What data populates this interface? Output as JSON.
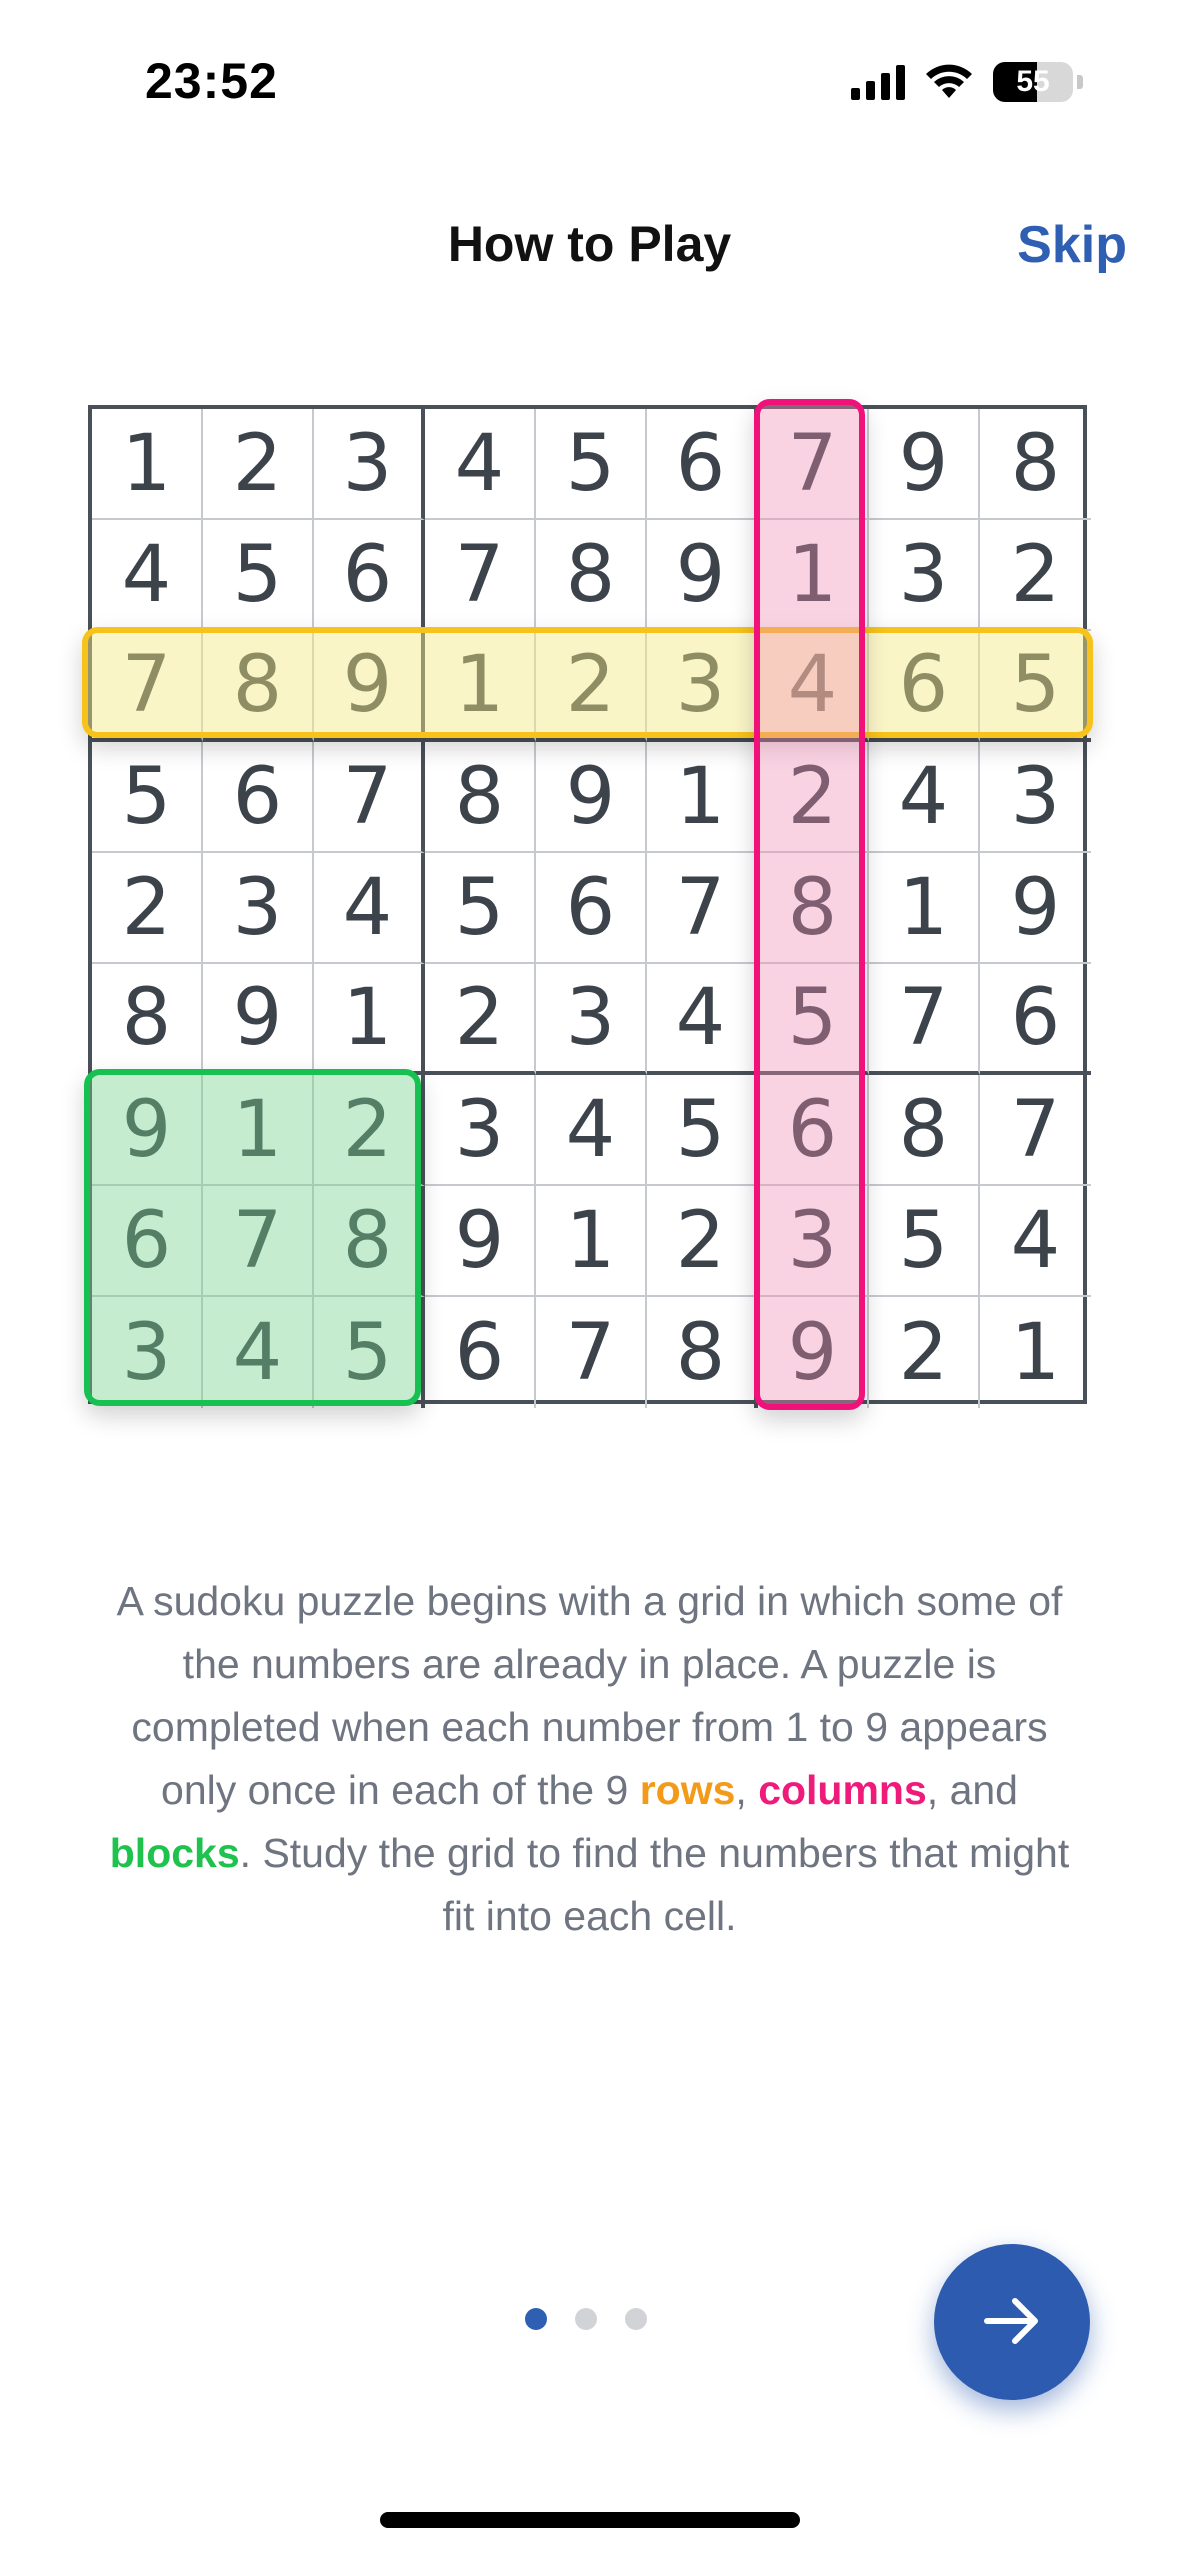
{
  "status_bar": {
    "time": "23:52",
    "battery": "55"
  },
  "header": {
    "title": "How to Play",
    "skip_label": "Skip"
  },
  "grid": {
    "rows": [
      [
        1,
        2,
        3,
        4,
        5,
        6,
        7,
        9,
        8
      ],
      [
        4,
        5,
        6,
        7,
        8,
        9,
        1,
        3,
        2
      ],
      [
        7,
        8,
        9,
        1,
        2,
        3,
        4,
        6,
        5
      ],
      [
        5,
        6,
        7,
        8,
        9,
        1,
        2,
        4,
        3
      ],
      [
        2,
        3,
        4,
        5,
        6,
        7,
        8,
        1,
        9
      ],
      [
        8,
        9,
        1,
        2,
        3,
        4,
        5,
        7,
        6
      ],
      [
        9,
        1,
        2,
        3,
        4,
        5,
        6,
        8,
        7
      ],
      [
        6,
        7,
        8,
        9,
        1,
        2,
        3,
        5,
        4
      ],
      [
        3,
        4,
        5,
        6,
        7,
        8,
        9,
        2,
        1
      ]
    ],
    "highlights": {
      "row_index": 2,
      "column_index": 6,
      "block": "bottom-left",
      "row_color": "#f7c21b",
      "column_color": "#f0127a",
      "block_color": "#17c151"
    }
  },
  "description": {
    "part1": "A sudoku puzzle begins with a grid in which some of the numbers are already in place. A puzzle is completed when each number from 1 to 9 appears only once in each of the 9 ",
    "rows_word": "rows",
    "sep1": ", ",
    "columns_word": "columns",
    "sep2": ", and ",
    "blocks_word": "blocks",
    "part2": ". Study the grid to find the numbers that might fit into each cell."
  },
  "pagination": {
    "total": 3,
    "active": 0
  },
  "next_button": {
    "icon": "arrow-right-icon"
  },
  "colors": {
    "accent": "#2f5fb3",
    "rows": "#f39a18",
    "columns": "#ee1b7a",
    "blocks": "#20c24e"
  }
}
